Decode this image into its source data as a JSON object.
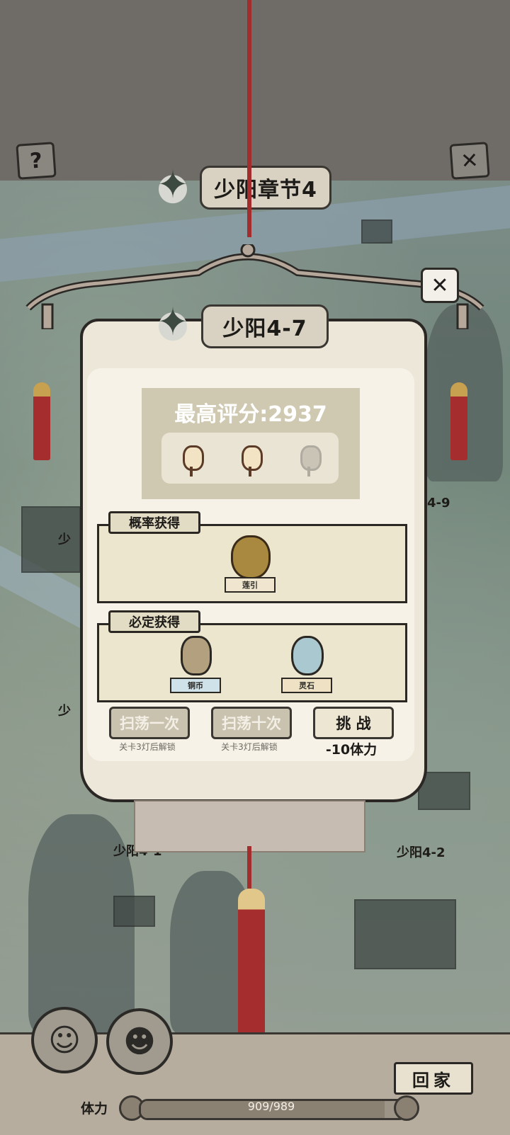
{
  "top": {
    "help_icon": "?",
    "close_icon": "✕"
  },
  "chapter": {
    "title": "少阳章节4"
  },
  "stage": {
    "title": "少阳4-7",
    "best_score": "最高评分:2937",
    "lanterns_lit": 2,
    "lanterns_total": 3
  },
  "rewards": {
    "chance_label": "概率获得",
    "chance_items": [
      {
        "name": "莲引",
        "icon": "pouch-icon"
      }
    ],
    "sure_label": "必定获得",
    "sure_items": [
      {
        "name": "铜币",
        "icon": "coin-icon"
      },
      {
        "name": "灵石",
        "icon": "spirit-stone-icon"
      }
    ]
  },
  "actions": {
    "sweep_once": "扫荡一次",
    "sweep_once_hint": "关卡3灯后解锁",
    "sweep_ten": "扫荡十次",
    "sweep_ten_hint": "关卡3灯后解锁",
    "challenge": "挑 战",
    "challenge_cost": "-10体力"
  },
  "map_labels": {
    "stage_4_9": "4-9",
    "stage_left_a": "少",
    "stage_left_b": "少",
    "stage_4_1": "少阳4-1",
    "stage_4_2": "少阳4-2"
  },
  "bottom": {
    "home": "回家",
    "stamina_label": "体力",
    "stamina_value": "909/989",
    "stamina_fraction": 0.919
  },
  "colors": {
    "rope": "#a32c2c",
    "panel": "#ece7d8",
    "score_box": "#cfc9b2"
  }
}
